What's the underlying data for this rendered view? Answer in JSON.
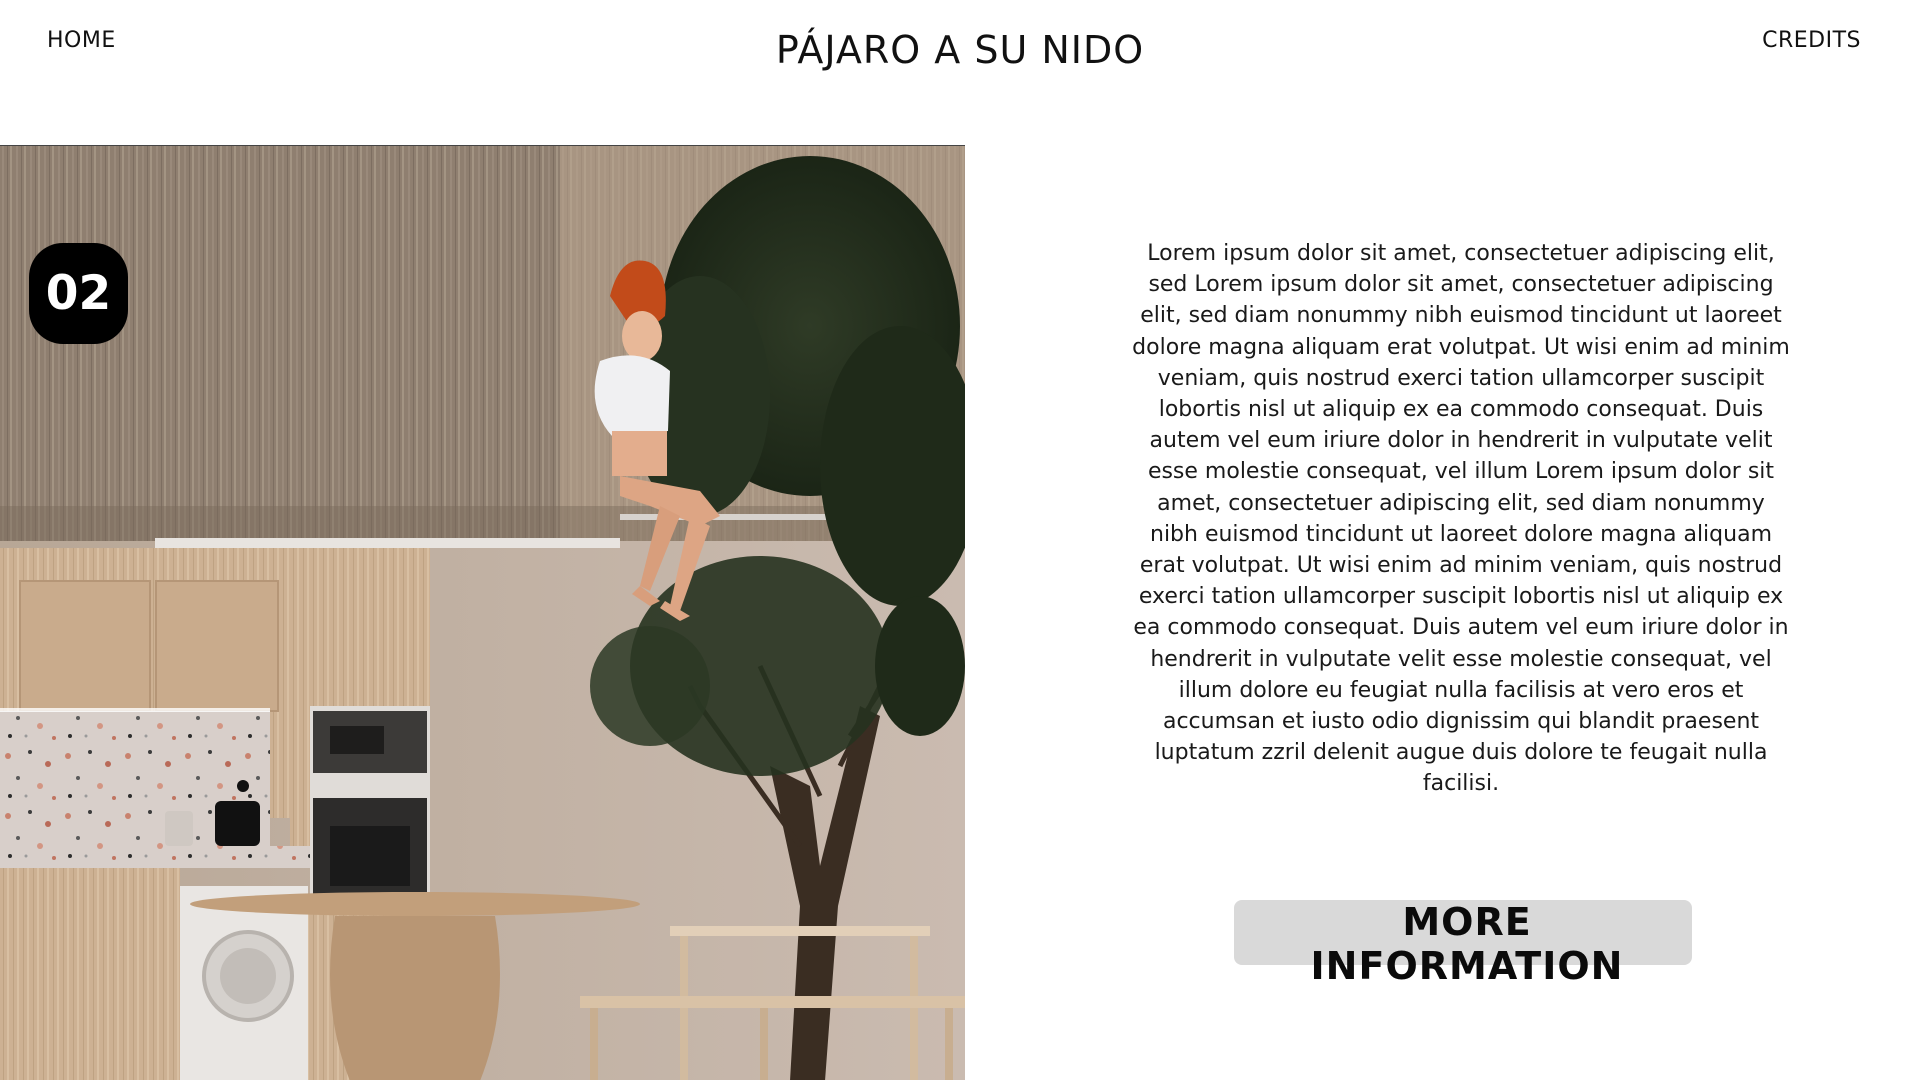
{
  "header": {
    "home_label": "HOME",
    "title": "PÁJARO A SU NIDO",
    "credits_label": "CREDITS"
  },
  "hero": {
    "step_number": "02"
  },
  "content": {
    "paragraph": "Lorem ipsum dolor sit amet, consectetuer adipiscing elit, sed Lorem ipsum dolor sit amet, consectetuer adipiscing elit, sed diam nonummy nibh euismod tincidunt ut laoreet dolore magna aliquam erat volutpat. Ut wisi enim ad minim veniam, quis nostrud exerci tation ullamcorper suscipit lobortis nisl ut aliquip ex ea commodo consequat. Duis autem vel eum iriure dolor in hendrerit in vulputate velit esse molestie consequat, vel illum Lorem ipsum dolor sit amet, consectetuer adipiscing elit, sed diam nonummy nibh euismod tincidunt ut laoreet dolore magna aliquam erat volutpat. Ut wisi enim ad minim veniam, quis nostrud exerci tation ullamcorper suscipit lobortis nisl ut aliquip ex ea commodo consequat. Duis autem vel eum iriure dolor in hendrerit in vulputate velit esse molestie consequat, vel illum dolore eu feugiat nulla facilisis at vero eros et accumsan et iusto odio dignissim qui blandit praesent luptatum zzril delenit augue duis dolore te feugait nulla facilisi.",
    "button_label": "MORE INFORMATION"
  },
  "colors": {
    "background": "#ffffff",
    "badge": "#000000",
    "button": "#d9d9d9",
    "text": "#111111"
  }
}
